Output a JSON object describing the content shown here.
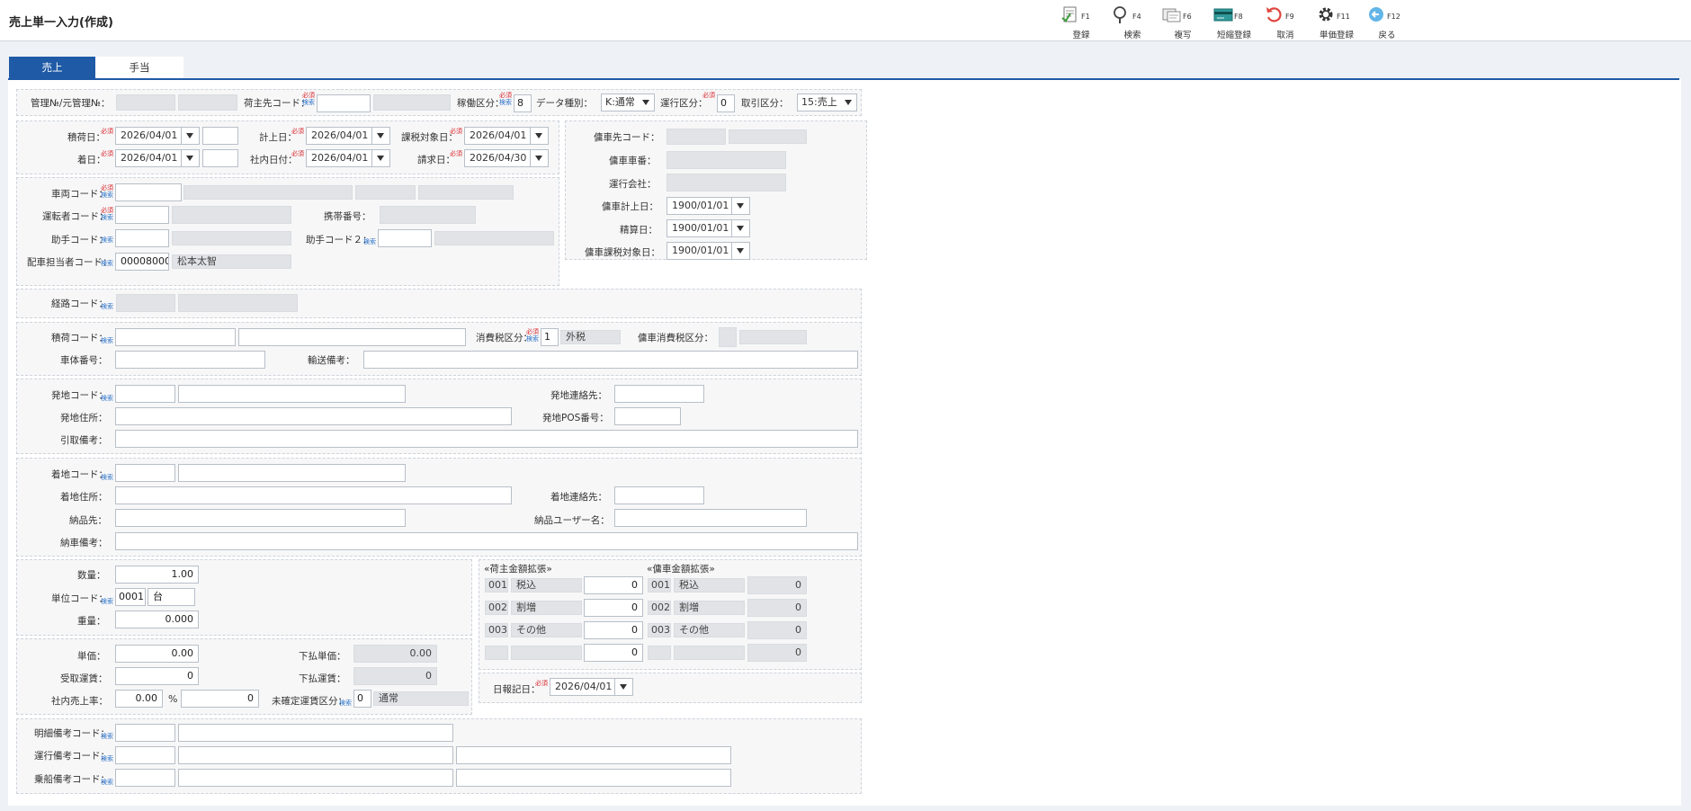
{
  "window": {
    "title": "売上単一入力(作成)"
  },
  "toolbar": [
    {
      "key": "F1",
      "label": "登録",
      "icon": "register-icon"
    },
    {
      "key": "F4",
      "label": "検索",
      "icon": "search-icon"
    },
    {
      "key": "F6",
      "label": "複写",
      "icon": "copy-icon"
    },
    {
      "key": "F8",
      "label": "短縮登録",
      "icon": "card-icon"
    },
    {
      "key": "F9",
      "label": "取消",
      "icon": "undo-icon"
    },
    {
      "key": "F11",
      "label": "単価登録",
      "icon": "gear-icon"
    },
    {
      "key": "F12",
      "label": "戻る",
      "icon": "back-icon"
    }
  ],
  "tabs": [
    "売上",
    "手当"
  ],
  "badges": {
    "required": "必須",
    "search": "検索"
  },
  "s1": {
    "kanri": "管理№/元管理№：",
    "ninushi": "荷主先コード：",
    "kadou": "稼働区分：",
    "kadou_val": "8",
    "data": "データ種別：",
    "data_val": "K:通常",
    "unkou": "運行区分：",
    "unkou_val": "0",
    "torihiki": "取引区分：",
    "torihiki_val": "15:売上"
  },
  "s2": {
    "tsumi": "積荷日：",
    "tsumi_val": "2026/04/01",
    "chaku": "着日：",
    "chaku_val": "2026/04/01",
    "keijo": "計上日：",
    "keijo_val": "2026/04/01",
    "shanai": "社内日付：",
    "shanai_val": "2026/04/01",
    "kazei": "課税対象日：",
    "kazei_val": "2026/04/01",
    "seikyu": "請求日：",
    "seikyu_val": "2026/04/30"
  },
  "s3": {
    "sharyo": "車両コード：",
    "untensha": "運転者コード：",
    "keitai": "携帯番号：",
    "joshu": "助手コード：",
    "joshu2": "助手コード２：",
    "haisha": "配車担当者コード：",
    "haisha_code": "00008000",
    "haisha_name": "松本太智"
  },
  "yosha": {
    "code": "傭車先コード：",
    "bango": "傭車車番：",
    "kaisha": "運行会社：",
    "keijo": "傭車計上日：",
    "keijo_val": "1900/01/01",
    "seisan": "精算日：",
    "seisan_val": "1900/01/01",
    "kazei": "傭車課税対象日：",
    "kazei_val": "1900/01/01"
  },
  "keiro": {
    "label": "経路コード："
  },
  "s5": {
    "tsumini": "積荷コード：",
    "shohizei": "消費税区分：",
    "shohizei_val": "1",
    "shohizei_name": "外税",
    "yosha_zei": "傭車消費税区分：",
    "shatai": "車体番号：",
    "yuso": "輸送備考："
  },
  "hatsu": {
    "code": "発地コード：",
    "renraku": "発地連絡先：",
    "jusho": "発地住所：",
    "pos": "発地POS番号：",
    "hikitori": "引取備考："
  },
  "chakuchi": {
    "code": "着地コード：",
    "jusho": "着地住所：",
    "renraku": "着地連絡先：",
    "nohin": "納品先：",
    "user": "納品ユーザー名：",
    "nosha": "納車備考："
  },
  "qty": {
    "suryo": "数量：",
    "suryo_val": "1.00",
    "tani": "単位コード：",
    "tani_code": "0001",
    "tani_name": "台",
    "juryo": "重量：",
    "juryo_val": "0.000"
  },
  "price": {
    "tanka": "単価：",
    "tanka_val": "0.00",
    "uketori": "受取運賃：",
    "uketori_val": "0",
    "ritsu": "社内売上率：",
    "ritsu_val": "0.00",
    "pct": "%",
    "ritsu_amt": "0",
    "shita_tanka": "下払単価：",
    "shita_tanka_val": "0.00",
    "shita_unchin": "下払運賃：",
    "shita_unchin_val": "0",
    "mikakutei": "未確定運賃区分：",
    "mikakutei_val": "0",
    "mikakutei_name": "通常"
  },
  "ext": {
    "ninushi_title": "«荷主金額拡張»",
    "yosha_title": "«傭車金額拡張»",
    "ninushi_rows": [
      {
        "code": "001",
        "name": "税込",
        "val": "0"
      },
      {
        "code": "002",
        "name": "割増",
        "val": "0"
      },
      {
        "code": "003",
        "name": "その他",
        "val": "0"
      },
      {
        "code": "",
        "name": "",
        "val": "0"
      }
    ],
    "yosha_rows": [
      {
        "code": "001",
        "name": "税込",
        "val": "0"
      },
      {
        "code": "002",
        "name": "割増",
        "val": "0"
      },
      {
        "code": "003",
        "name": "その他",
        "val": "0"
      },
      {
        "code": "",
        "name": "",
        "val": "0"
      }
    ]
  },
  "nippo": {
    "label": "日報記日：",
    "val": "2026/04/01"
  },
  "biko": {
    "meisai": "明細備考コード：",
    "unko": "運行備考コード：",
    "josen": "乗船備考コード："
  }
}
